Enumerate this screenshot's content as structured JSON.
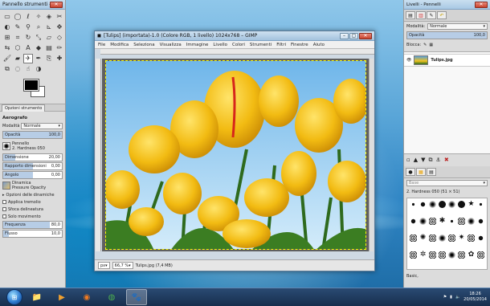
{
  "toolbox": {
    "title": "Pannello strumenti - O...",
    "tab_label": "Opzioni strumento",
    "tool_name": "Aerografo",
    "mode_label": "Modalità",
    "mode_value": "Normale",
    "opacity_label": "Opacità",
    "opacity_value": "100,0",
    "brush_label": "Pennello",
    "brush_value": "2. Hardness 050",
    "size_label": "Dimensione",
    "size_value": "20,00",
    "aspect_label": "Rapporto dimensioni",
    "aspect_value": "0,00",
    "angle_label": "Angolo",
    "angle_value": "0,00",
    "dynamics_label": "Dinamica",
    "dynamics_value": "Pressure Opacity",
    "dynamics_options_label": "Opzioni delle dinamiche",
    "jitter_label": "Applica tremolio",
    "smooth_label": "Sfoca delineatura",
    "incremental_label": "Solo movimento",
    "rate_label": "Frequenza",
    "rate_value": "80,0",
    "flow_label": "Flusso",
    "flow_value": "10,0"
  },
  "image_window": {
    "title": "[Tulips] (importata)-1.0 (Colore RGB, 1 livello) 1024x768 – GIMP",
    "menu": [
      "File",
      "Modifica",
      "Seleziona",
      "Visualizza",
      "Immagine",
      "Livello",
      "Colori",
      "Strumenti",
      "Filtri",
      "Finestre",
      "Aiuto"
    ],
    "unit": "px",
    "zoom": "66,7 %",
    "file_info": "Tulips.jpg (7,4 MB)"
  },
  "dock": {
    "title": "Livelli - Pennelli",
    "mode_label": "Modalità:",
    "mode_value": "Normale",
    "opacity_label": "Opacità",
    "opacity_value": "100,0",
    "lock_label": "Blocca:",
    "layer_name": "Tulips.jpg",
    "brushes_tag_placeholder": "Base",
    "brush_selected": "2. Hardness 050 (51 × 51)",
    "brush_footer": "Basic,"
  },
  "taskbar": {
    "time": "18:26",
    "date": "20/05/2014"
  },
  "colors": {
    "fill_bar": "#b7cde6"
  }
}
